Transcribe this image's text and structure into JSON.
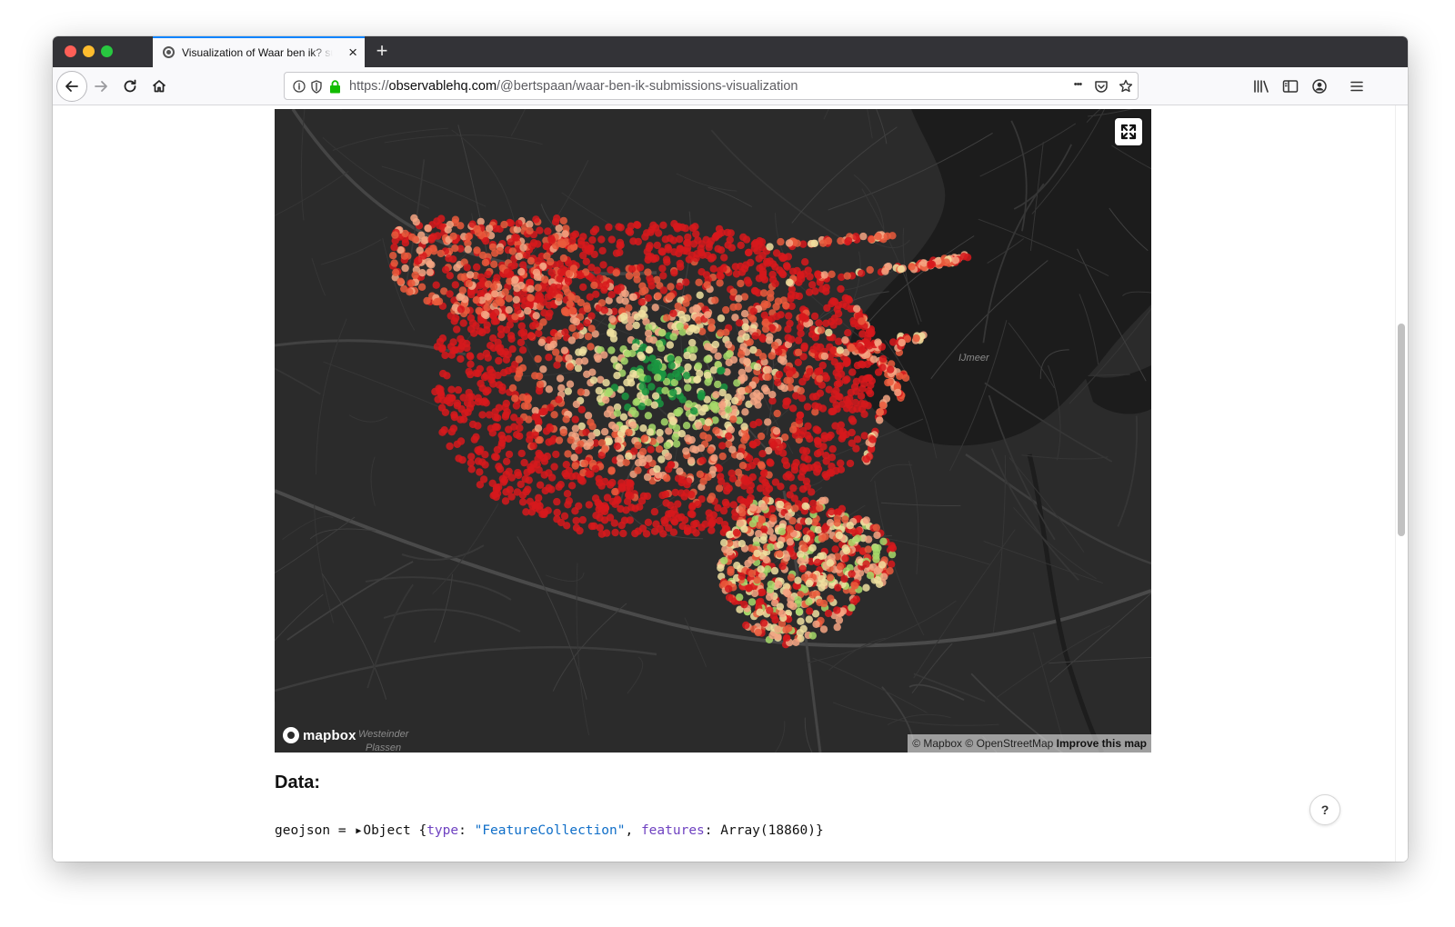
{
  "browser": {
    "tab": {
      "title": "Visualization of Waar ben ik? submissions",
      "close_label": "×"
    },
    "new_tab_label": "+",
    "url": {
      "protocol": "https://",
      "host": "observablehq.com",
      "path": "/@bertspaan/waar-ben-ik-submissions-visualization"
    },
    "icons": {
      "back": "arrow-left-icon",
      "forward": "arrow-right-icon",
      "reload": "reload-icon",
      "home": "home-icon",
      "info": "info-icon",
      "tracking": "shield-icon",
      "lock": "lock-icon",
      "more": "more-actions-icon",
      "pocket": "pocket-icon",
      "bookmark": "star-icon",
      "library": "library-icon",
      "sidebar": "sidebar-icon",
      "account": "account-icon",
      "menu": "hamburger-menu-icon"
    },
    "more_label": "•••"
  },
  "map": {
    "attribution": {
      "mapbox": "© Mapbox",
      "osm": "© OpenStreetMap",
      "improve": "Improve this map"
    },
    "logo_text": "mapbox",
    "place_labels": {
      "ijmeer": "IJmeer",
      "westeinder": "Westeinder",
      "plassen": "Plassen"
    },
    "colors": {
      "background": "#2b2b2b",
      "water": "#1b1b1b",
      "roads": "#3d3d3d",
      "point_palette": [
        "#d7191c",
        "#ea5a3c",
        "#f4a582",
        "#f0e0a0",
        "#a6d96a",
        "#1a9641"
      ]
    }
  },
  "content": {
    "data_heading": "Data:",
    "code": {
      "name": "geojson",
      "equals": " = ",
      "object_word": "Object",
      "open": " {",
      "type_key": "type",
      "type_value": "\"FeatureCollection\"",
      "sep": ", ",
      "features_key": "features",
      "colon": ": ",
      "features_value": "Array(18860)",
      "close": "}"
    },
    "help_label": "?"
  }
}
